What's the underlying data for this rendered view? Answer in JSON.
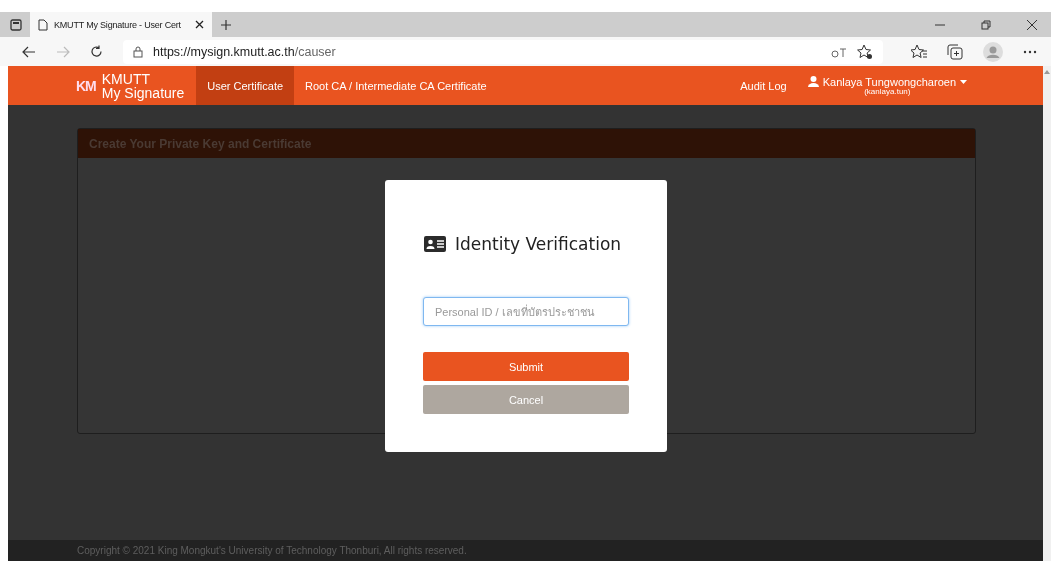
{
  "browser": {
    "tab_title": "KMUTT My Signature - User Cert",
    "url_host": "https://mysign.kmutt.ac.th",
    "url_path": "/causer"
  },
  "navbar": {
    "brand_line1": "KMUTT",
    "brand_line2": "My Signature",
    "logo_text": "KM",
    "items": [
      {
        "label": "User Certificate",
        "selected": true
      },
      {
        "label": "Root CA / Intermediate CA Certificate",
        "selected": false
      }
    ],
    "audit_log": "Audit Log",
    "user_name": "Kanlaya Tungwongcharoen",
    "user_id": "(kanlaya.tun)"
  },
  "panel": {
    "title": "Create Your Private Key and Certificate"
  },
  "modal": {
    "title": "Identity Verification",
    "placeholder": "Personal ID / เลขที่บัตรประชาชน",
    "buttons": [
      {
        "label": "Submit",
        "kind": "primary"
      },
      {
        "label": "Cancel",
        "kind": "secondary"
      }
    ]
  },
  "footer": "Copyright © 2021 King Mongkut's University of Technology Thonburi, All rights reserved."
}
